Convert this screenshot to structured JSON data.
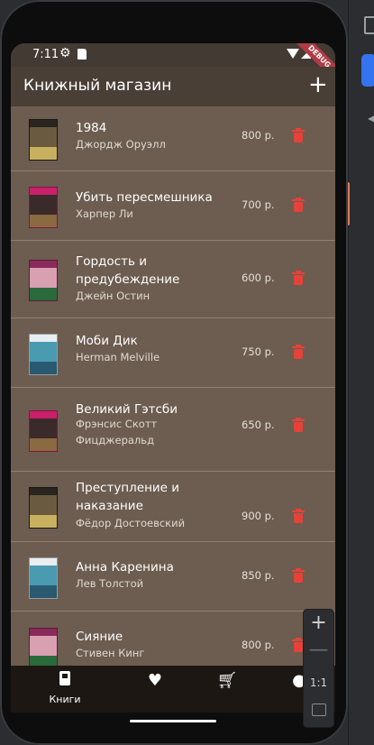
{
  "status_bar": {
    "time": "7:11",
    "debug_label": "DEBUG"
  },
  "app_bar": {
    "title": "Книжный магазин",
    "add_icon": "+"
  },
  "books": [
    {
      "title": "1984",
      "author": "Джордж Оруэлл",
      "price": "800 р.",
      "cover_colors": [
        "#2a2520",
        "#6a5a40",
        "#c8b060"
      ]
    },
    {
      "title": "Убить пересмешника",
      "author": "Харпер Ли",
      "price": "700 р.",
      "cover_colors": [
        "#c8206a",
        "#3b2a2a",
        "#8a6a40"
      ]
    },
    {
      "title": "Гордость и предубеждение",
      "author": "Джейн Остин",
      "price": "600 р.",
      "cover_colors": [
        "#8a2a5a",
        "#d8a0b0",
        "#2a6a3a"
      ]
    },
    {
      "title": "Моби Дик",
      "author": "Herman Melville",
      "price": "750 р.",
      "cover_colors": [
        "#e8eef0",
        "#4a9ab0",
        "#2a5a70"
      ]
    },
    {
      "title": "Великий Гэтсби",
      "author": "Фрэнсис Скотт Фицджеральд",
      "price": "650 р.",
      "cover_colors": [
        "#c8206a",
        "#3b2a2a",
        "#8a6a40"
      ]
    },
    {
      "title": "Преступление и наказание",
      "author": "Фёдор Достоевский",
      "price": "900 р.",
      "cover_colors": [
        "#2a2520",
        "#6a5a40",
        "#c8b060"
      ]
    },
    {
      "title": "Анна Каренина",
      "author": "Лев Толстой",
      "price": "850 р.",
      "cover_colors": [
        "#e8eef0",
        "#4a9ab0",
        "#2a5a70"
      ]
    },
    {
      "title": "Сияние",
      "author": "Стивен Кинг",
      "price": "800 р.",
      "cover_colors": [
        "#8a2a5a",
        "#d8a0b0",
        "#2a6a3a"
      ]
    }
  ],
  "bottom_nav": {
    "items": [
      {
        "label": "Книги",
        "icon": "book-icon"
      },
      {
        "label": "",
        "icon": "heart-icon"
      },
      {
        "label": "",
        "icon": "cart-icon"
      },
      {
        "label": "",
        "icon": "person-icon"
      }
    ]
  },
  "zoom_panel": {
    "zoom_in": "+",
    "zoom_out": "—",
    "reset": "1:1"
  },
  "colors": {
    "trash": "#e5423a",
    "app_bar": "#4a3f36",
    "list_bg": "#6c5d50",
    "nav_bg": "#1d1714"
  }
}
